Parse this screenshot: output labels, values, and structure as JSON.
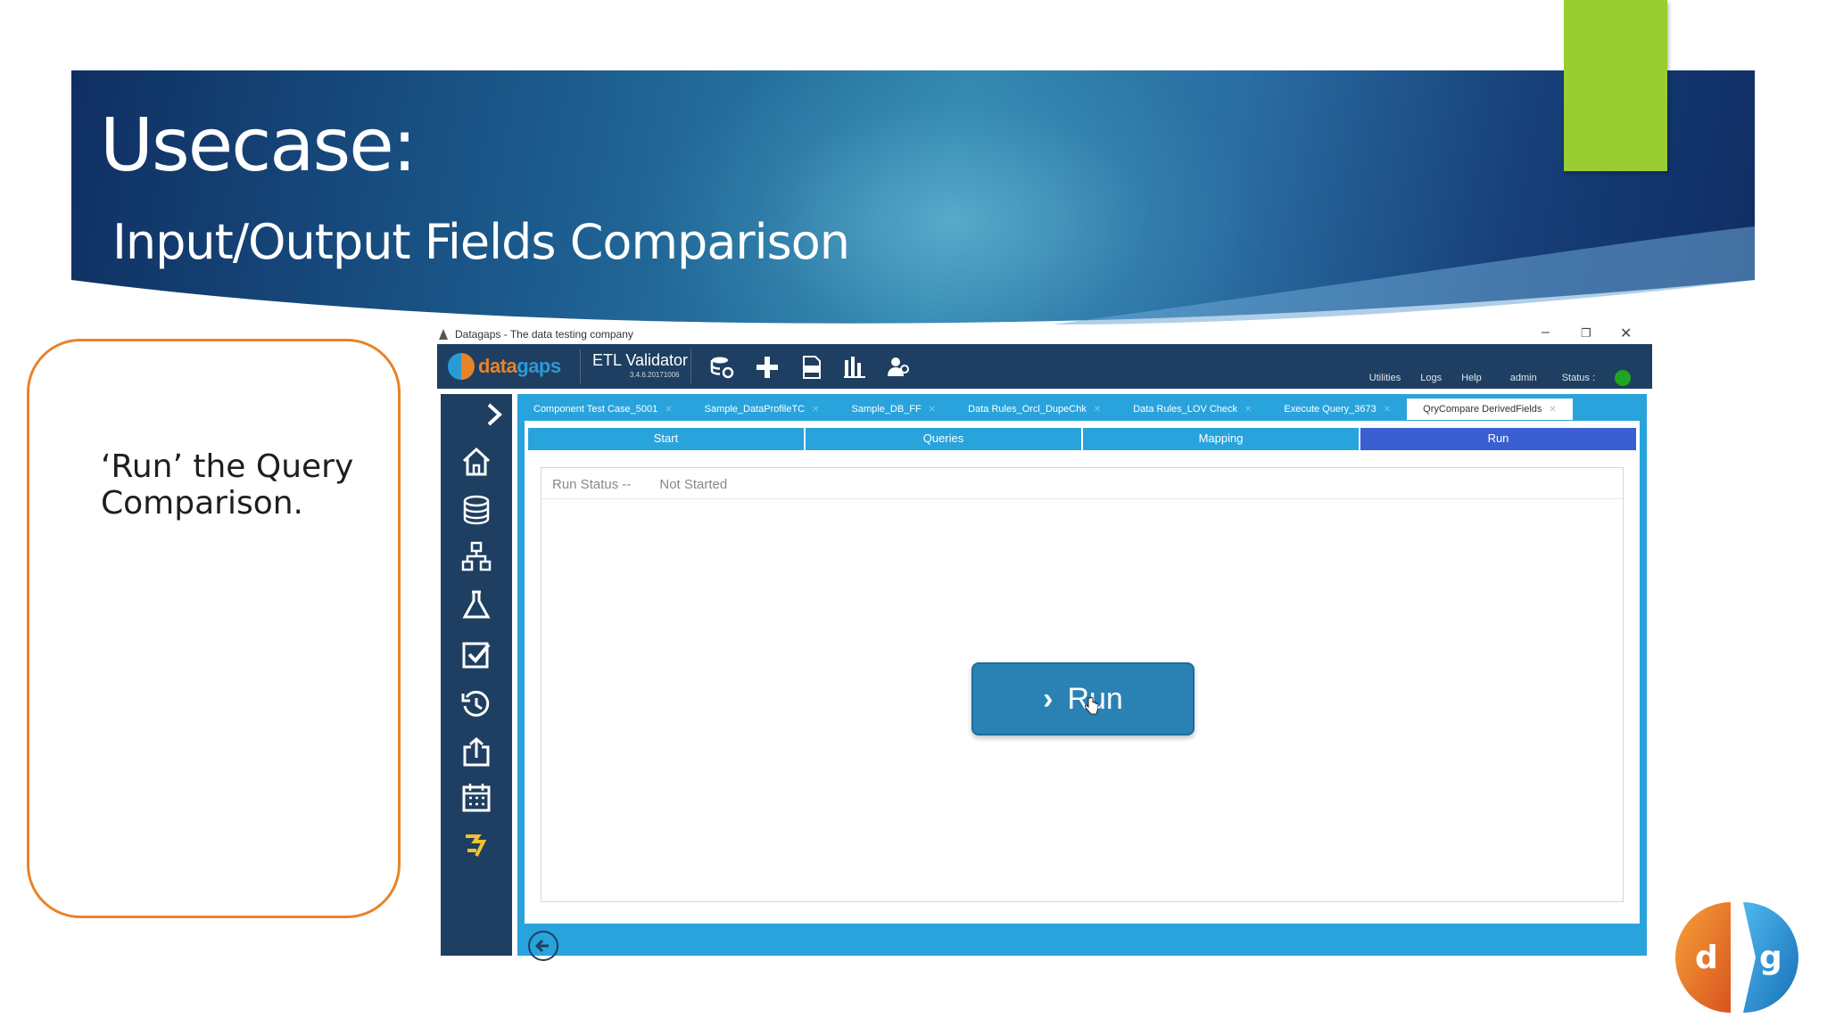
{
  "slide": {
    "title": "Usecase:",
    "subtitle": "Input/Output Fields Comparison",
    "callout_text": "‘Run’ the Query Comparison."
  },
  "window": {
    "title": "Datagaps - The data testing company",
    "controls": [
      "–",
      "❐",
      "✕"
    ]
  },
  "app": {
    "logo_data": "data",
    "logo_gaps": "gaps",
    "product_name": "ETL Validator",
    "product_version": "3.4.6.20171006",
    "toolbar_icons": [
      "database-settings-icon",
      "add-icon",
      "sql-icon",
      "chart-icon",
      "users-icon"
    ],
    "top_links": {
      "utilities": "Utilities",
      "logs": "Logs",
      "help": "Help",
      "user": "admin",
      "status": "Status :"
    },
    "status_color": "#1fa51f"
  },
  "sidebar": {
    "icons": [
      "home-icon",
      "database-icon",
      "hierarchy-icon",
      "flask-icon",
      "checkbox-icon",
      "history-icon",
      "export-icon",
      "calendar-icon",
      "tools-icon"
    ]
  },
  "tabs": [
    {
      "label": "Component Test Case_5001"
    },
    {
      "label": "Sample_DataProfileTC"
    },
    {
      "label": "Sample_DB_FF"
    },
    {
      "label": "Data Rules_Orcl_DupeChk"
    },
    {
      "label": "Data Rules_LOV Check"
    },
    {
      "label": "Execute Query_3673"
    },
    {
      "label": "QryCompare DerivedFields"
    }
  ],
  "steps": {
    "start": "Start",
    "queries": "Queries",
    "mapping": "Mapping",
    "run": "Run"
  },
  "run_panel": {
    "status_label": "Run Status --",
    "status_value": "Not Started",
    "run_button": "Run"
  },
  "colors": {
    "accent_green": "#9acd32",
    "callout_border": "#e8832a",
    "app_dark": "#1e3f61",
    "app_blue": "#29a3dc",
    "active_step": "#3a5fd1"
  }
}
